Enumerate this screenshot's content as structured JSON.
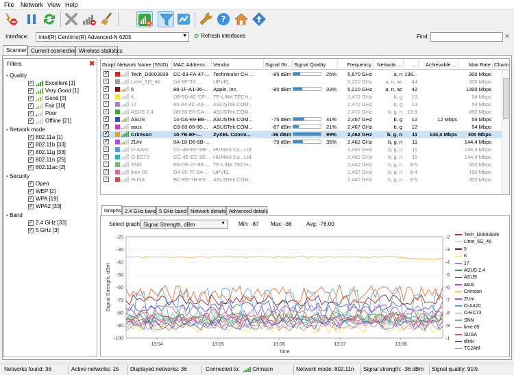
{
  "menu": [
    "File",
    "Network",
    "View",
    "Help"
  ],
  "toolbar": {
    "buttons": [
      "start-stop-icon",
      "pause-icon",
      "refresh-icon",
      "clear-icon",
      "signal-icon",
      "broom-icon",
      "rss-icon",
      "filter-icon",
      "gauge-icon",
      "wrench-icon",
      "help-icon",
      "home-icon",
      "update-icon"
    ]
  },
  "interface": {
    "label": "Interface:",
    "value": "Intel(R) Centrino(R) Advanced-N 6205",
    "refresh_label": "Refresh interfaces",
    "find_label": "Find:",
    "find_value": ""
  },
  "tabs": [
    "Scanner",
    "Current connection",
    "Wireless statistics"
  ],
  "filters": {
    "title": "Filters",
    "groups": [
      {
        "name": "Quality",
        "items": [
          "Excellent [1]",
          "Very Good [1]",
          "Good [3]",
          "Fair [10]",
          "Poor",
          "Offline [21]"
        ]
      },
      {
        "name": "Network mode",
        "items": [
          "802.11a [1]",
          "802.11b [33]",
          "802.11g [33]",
          "802.11n [25]",
          "802.11ac [2]"
        ]
      },
      {
        "name": "Security",
        "items": [
          "Open",
          "WEP [2]",
          "WPA [19]",
          "WPA2 [33]"
        ]
      },
      {
        "name": "Band",
        "items": [
          "2.4 GHz [33]",
          "5 GHz [3]"
        ]
      }
    ],
    "quality_colors": [
      "#3aa63a",
      "#6fbe3a",
      "#9ec93a",
      "#cfa63a",
      "#c9543a",
      "#999999"
    ]
  },
  "table": {
    "headers": [
      "Graph",
      "Network Name (SSID)",
      "MAC Address...",
      "Vendor",
      "Signal Str...",
      "Signal Quality",
      "Frequency",
      "Network ...",
      "...",
      "Achievable ...",
      "Max Rate",
      "Chann"
    ],
    "rows": [
      {
        "color": "#e02020",
        "ssid": "Tech_D0003939",
        "mac": "CC-03-FA-47-...",
        "vendor": "Technicolor CH ...",
        "signal": "-85 dBm",
        "quality": "25%",
        "qval": 25,
        "freq": "5,670 GHz",
        "mode": "a, n",
        "ch": "136...",
        "ach": "",
        "max": "300 Mbps",
        "dim": false,
        "bold": false,
        "sel": false
      },
      {
        "color": "#a0a0a0",
        "ssid": "Lime_5G_46",
        "mac": "D4-8F-33-...",
        "vendor": "UPVEL",
        "signal": "",
        "quality": "",
        "qval": 0,
        "freq": "5,220 GHz",
        "mode": "a, n, ac",
        "ch": "44",
        "ach": "",
        "max": "300 Mbps",
        "dim": true,
        "bold": false,
        "sel": false
      },
      {
        "color": "#8a1010",
        "ssid": "5",
        "mac": "88-1F-A1-36-...",
        "vendor": "Apple, Inc.",
        "signal": "-80 dBm",
        "quality": "33%",
        "qval": 33,
        "freq": "5,210 GHz",
        "mode": "a, n, ac",
        "ch": "42",
        "ach": "",
        "max": "1300 Mbps",
        "dim": false,
        "bold": false,
        "sel": false
      },
      {
        "color": "#f0e040",
        "ssid": "K",
        "mac": "D8-5D-4C-CF-...",
        "vendor": "TP-LINK TECH...",
        "signal": "",
        "quality": "",
        "qval": 0,
        "freq": "2,472 GHz",
        "mode": "b, g",
        "ch": "13",
        "ach": "",
        "max": "54 Mbps",
        "dim": true,
        "bold": false,
        "sel": false
      },
      {
        "color": "#b080d0",
        "ssid": "17",
        "mac": "60-A4-4C-A3-...",
        "vendor": "ASUSTek COM...",
        "signal": "",
        "quality": "",
        "qval": 0,
        "freq": "2,472 GHz",
        "mode": "b, g",
        "ch": "13",
        "ach": "",
        "max": "54 Mbps",
        "dim": true,
        "bold": false,
        "sel": false
      },
      {
        "color": "#40a040",
        "ssid": "ASUS 2.4",
        "mac": "D8-50-E6-CA-...",
        "vendor": "ASUSTek COM...",
        "signal": "",
        "quality": "",
        "qval": 0,
        "freq": "2,472 GHz",
        "mode": "b, g, n",
        "ch": "13-9",
        "ach": "",
        "max": "450 Mbps",
        "dim": true,
        "bold": false,
        "sel": false
      },
      {
        "color": "#3050c0",
        "ssid": "ASUS",
        "mac": "14-DA-E9-BB-...",
        "vendor": "ASUSTek COM...",
        "signal": "-75 dBm",
        "quality": "41%",
        "qval": 41,
        "freq": "2,467 GHz",
        "mode": "b, g",
        "ch": "12",
        "ach": "12 Mbps",
        "max": "54 Mbps",
        "dim": false,
        "bold": false,
        "sel": false
      },
      {
        "color": "#c040c0",
        "ssid": "asus",
        "mac": "C8-60-00-66-...",
        "vendor": "ASUSTek COM...",
        "signal": "-87 dBm",
        "quality": "21%",
        "qval": 21,
        "freq": "2,467 GHz",
        "mode": "b, g",
        "ch": "12",
        "ach": "",
        "max": "54 Mbps",
        "dim": false,
        "bold": false,
        "sel": false
      },
      {
        "color": "#f0a020",
        "ssid": "Crimson",
        "mac": "10-7B-EF-...",
        "vendor": "ZyXEL Comm...",
        "signal": "-36 dBm",
        "quality": "99%",
        "qval": 99,
        "freq": "2,462 GHz",
        "mode": "b, g, n",
        "ch": "11",
        "ach": "144,4 Mbps",
        "max": "300 Mbps",
        "dim": false,
        "bold": true,
        "sel": true
      },
      {
        "color": "#a050d0",
        "ssid": "ZUni",
        "mac": "0A-18-D6-6B-...",
        "vendor": "",
        "signal": "-79 dBm",
        "quality": "35%",
        "qval": 35,
        "freq": "2,462 GHz",
        "mode": "b, g, n",
        "ch": "11",
        "ach": "",
        "max": "144,4 Mbps",
        "dim": false,
        "bold": false,
        "sel": false
      },
      {
        "color": "#50a0d0",
        "ssid": "O-A42C",
        "mac": "CC-4E-EC-9B-...",
        "vendor": "HUMAX Co., Ltd.",
        "signal": "",
        "quality": "",
        "qval": 0,
        "freq": "2,462 GHz",
        "mode": "b, g, n",
        "ch": "11",
        "ach": "",
        "max": "144,4 Mbps",
        "dim": true,
        "bold": false,
        "sel": false
      },
      {
        "color": "#30b0b0",
        "ssid": "O-EC73",
        "mac": "CC-4E-EC-9E-...",
        "vendor": "HUMAX Co., Ltd.",
        "signal": "",
        "quality": "",
        "qval": 0,
        "freq": "2,462 GHz",
        "mode": "b, g, n",
        "ch": "11",
        "ach": "",
        "max": "144,4 Mbps",
        "dim": true,
        "bold": false,
        "sel": false
      },
      {
        "color": "#70c070",
        "ssid": "SNN",
        "mac": "E8-DE-27-88-...",
        "vendor": "TP-LINK TECH...",
        "signal": "",
        "quality": "",
        "qval": 0,
        "freq": "2,442 GHz",
        "mode": "b, g, n",
        "ch": "9-5",
        "ach": "",
        "max": "300 Mbps",
        "dim": true,
        "bold": false,
        "sel": false
      },
      {
        "color": "#d070a0",
        "ssid": "lime 05",
        "mac": "D4-8F-7F-54-...",
        "vendor": "UPVEL",
        "signal": "",
        "quality": "",
        "qval": 0,
        "freq": "2,437 GHz",
        "mode": "b, g, n",
        "ch": "8-4",
        "ach": "",
        "max": "150 Mbps",
        "dim": true,
        "bold": false,
        "sel": false
      },
      {
        "color": "#d05050",
        "ssid": "SUSA",
        "mac": "BC-EE-7B-E5-...",
        "vendor": "ASUSTek COM...",
        "signal": "",
        "quality": "",
        "qval": 0,
        "freq": "2,447 GHz",
        "mode": "b, g, n",
        "ch": "9-5",
        "ach": "",
        "max": "300 Mbps",
        "dim": true,
        "bold": false,
        "sel": false
      }
    ]
  },
  "bottom_tabs": [
    "Graphs",
    "2.4 GHz band",
    "5 GHz band",
    "Network details",
    "Advanced details"
  ],
  "graph": {
    "select_label": "Select graph:",
    "select_value": "Signal Strength, dBm",
    "min_label": "Min:",
    "min_value": "-87",
    "max_label": "Max:",
    "max_value": "-36",
    "avg_label": "Avg:",
    "avg_value": "-76,00"
  },
  "chart_data": {
    "type": "line",
    "ylabel": "Signal Strength, dBm",
    "xlabel": "Time",
    "ylim": [
      -100,
      -20
    ],
    "yticks": [
      -20,
      -30,
      -40,
      -50,
      -60,
      -70,
      -80,
      -90,
      -100
    ],
    "xticks": [
      "13:04",
      "13:05",
      "13:06",
      "13:07",
      "13:08"
    ],
    "series": [
      {
        "name": "Tech_D0003939",
        "color": "#e02020",
        "base": -85
      },
      {
        "name": "Lime_5G_46",
        "color": "#a0a0a0",
        "base": -88
      },
      {
        "name": "5",
        "color": "#8a1010",
        "base": -70
      },
      {
        "name": "K",
        "color": "#f0e040",
        "base": -91
      },
      {
        "name": "17",
        "color": "#b080d0",
        "base": -90
      },
      {
        "name": "ASUS 2.4",
        "color": "#40a040",
        "base": -84
      },
      {
        "name": "ASUS",
        "color": "#3050c0",
        "base": -75
      },
      {
        "name": "asus",
        "color": "#c040c0",
        "base": -86
      },
      {
        "name": "Crimson",
        "color": "#f0a020",
        "base": -36
      },
      {
        "name": "ZUni",
        "color": "#a050d0",
        "base": -78
      },
      {
        "name": "O-A42C",
        "color": "#50a0d0",
        "base": -72
      },
      {
        "name": "O-EC73",
        "color": "#30b0b0",
        "base": -85
      },
      {
        "name": "SNN",
        "color": "#70c070",
        "base": -83
      },
      {
        "name": "lime 05",
        "color": "#d070a0",
        "base": -87
      },
      {
        "name": "SUSA",
        "color": "#d05050",
        "base": -82
      },
      {
        "name": "dlink",
        "color": "#5060a0",
        "base": -89
      },
      {
        "name": "TC2AM",
        "color": "#f06020",
        "base": -65
      }
    ]
  },
  "status": {
    "networks_found": "Networks found: 36",
    "active_networks": "Active networks: 15",
    "displayed_networks": "Displayed networks: 36",
    "connected_label": "Connected to:",
    "connected_ssid": "Crimson",
    "network_mode": "Network mode: 802.11n",
    "signal_strength": "Signal strength: -36 dBm",
    "signal_quality": "Signal quality: 91%"
  }
}
